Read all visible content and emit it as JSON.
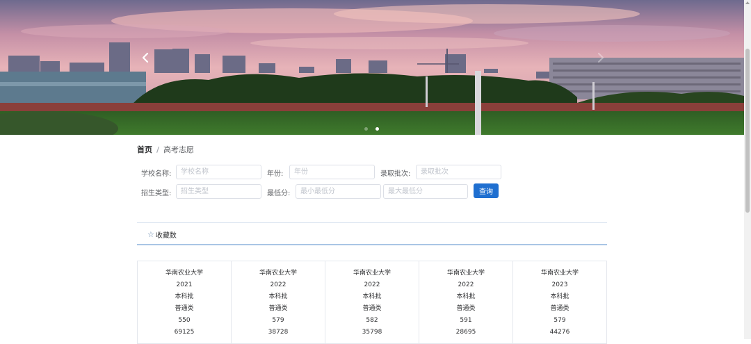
{
  "carousel": {
    "prev_icon": "chevron-left-icon",
    "next_icon": "chevron-right-icon",
    "dot_count": 2,
    "active_dot": 2
  },
  "breadcrumb": {
    "home": "首页",
    "separator": "/",
    "current": "高考志愿"
  },
  "filters": {
    "school_label": "学校名称:",
    "school_placeholder": "学校名称",
    "year_label": "年份:",
    "year_placeholder": "年份",
    "batch_label": "录取批次:",
    "batch_placeholder": "录取批次",
    "type_label": "招生类型:",
    "type_placeholder": "招生类型",
    "min_score_label": "最低分:",
    "min_low_placeholder": "最小最低分",
    "min_high_placeholder": "最大最低分",
    "query_button": "查询"
  },
  "favorites": {
    "icon": "star-outline-icon",
    "label": "收藏数"
  },
  "cards": [
    {
      "school": "华南农业大学",
      "year": "2021",
      "batch": "本科批",
      "type": "普通类",
      "score": "550",
      "rank": "69125"
    },
    {
      "school": "华南农业大学",
      "year": "2022",
      "batch": "本科批",
      "type": "普通类",
      "score": "579",
      "rank": "38728"
    },
    {
      "school": "华南农业大学",
      "year": "2022",
      "batch": "本科批",
      "type": "普通类",
      "score": "582",
      "rank": "35798"
    },
    {
      "school": "华南农业大学",
      "year": "2022",
      "batch": "本科批",
      "type": "普通类",
      "score": "591",
      "rank": "28695"
    },
    {
      "school": "华南农业大学",
      "year": "2023",
      "batch": "本科批",
      "type": "普通类",
      "score": "579",
      "rank": "44276"
    }
  ]
}
